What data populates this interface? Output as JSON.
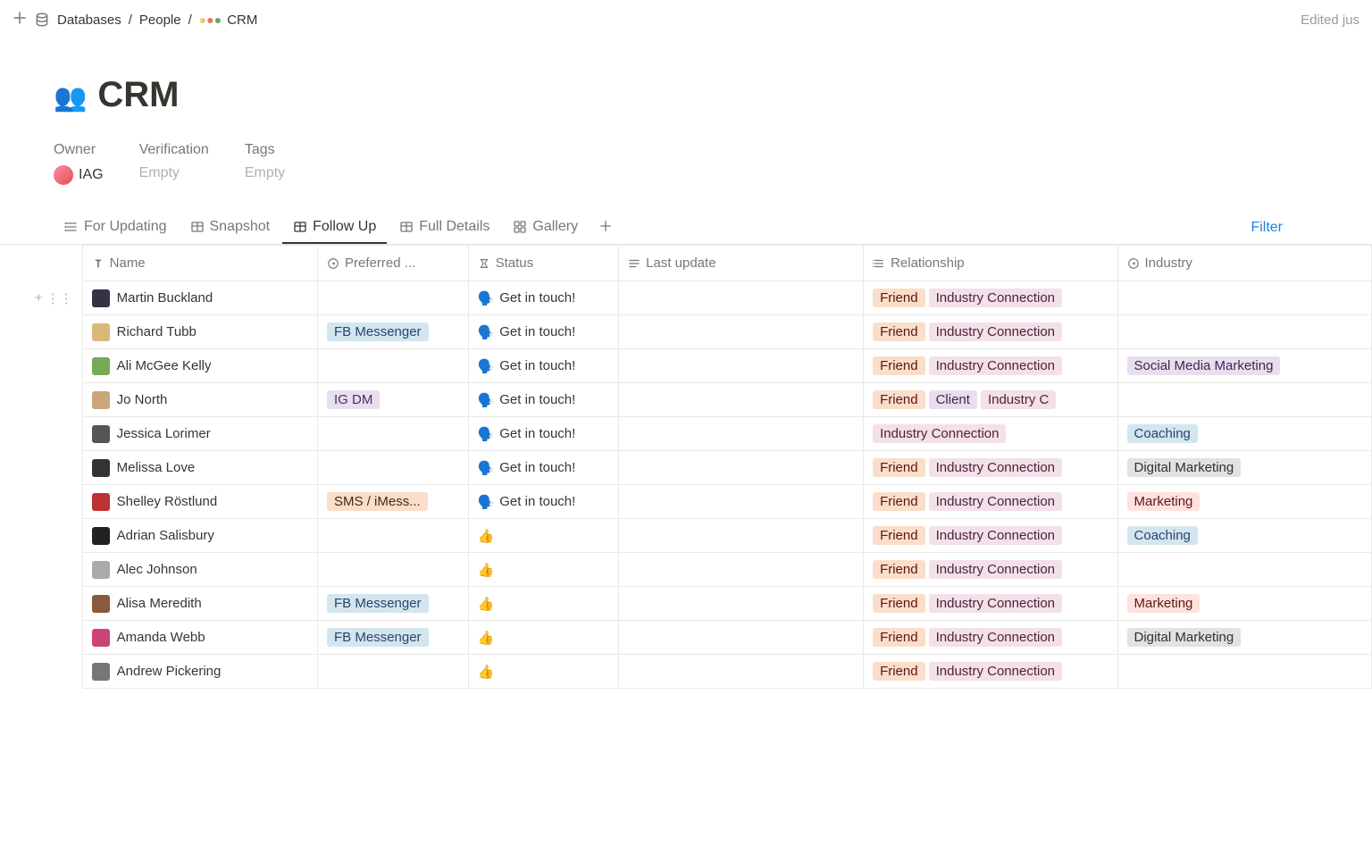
{
  "breadcrumb": {
    "root": "Databases",
    "parent": "People",
    "current": "CRM"
  },
  "edited": "Edited jus",
  "page": {
    "title": "CRM"
  },
  "props": {
    "owner_label": "Owner",
    "owner_value": "IAG",
    "verification_label": "Verification",
    "verification_value": "Empty",
    "tags_label": "Tags",
    "tags_value": "Empty"
  },
  "tabs": {
    "for_updating": "For Updating",
    "snapshot": "Snapshot",
    "follow_up": "Follow Up",
    "full_details": "Full Details",
    "gallery": "Gallery"
  },
  "filter_label": "Filter",
  "columns": {
    "name": "Name",
    "preferred": "Preferred ...",
    "status": "Status",
    "last_update": "Last update",
    "relationship": "Relationship",
    "industry": "Industry"
  },
  "emojis": {
    "get_in_touch": "🗣️",
    "thumbs_up": "👍"
  },
  "status_text": {
    "get_in_touch": "Get in touch!"
  },
  "tags": {
    "fb_messenger": "FB Messenger",
    "ig_dm": "IG DM",
    "sms": "SMS / iMess...",
    "friend": "Friend",
    "industry_conn_trunc": "Industry Connection",
    "industry_conn_short": "Industry C",
    "industry_conn_full": "Industry Connection",
    "client": "Client",
    "smm": "Social Media Marketing",
    "coaching": "Coaching",
    "dig_mkt": "Digital Marketing",
    "mkt": "Marketing"
  },
  "rows": [
    {
      "name": "Martin Buckland",
      "pref": "",
      "status": "get_in_touch",
      "rel": [
        "friend",
        "industry_conn_trunc"
      ],
      "ind": [],
      "avatar": "#334"
    },
    {
      "name": "Richard Tubb",
      "pref": "fb_messenger",
      "status": "get_in_touch",
      "rel": [
        "friend",
        "industry_conn_trunc"
      ],
      "ind": [],
      "avatar": "#d8b97a"
    },
    {
      "name": "Ali McGee Kelly",
      "pref": "",
      "status": "get_in_touch",
      "rel": [
        "friend",
        "industry_conn_trunc"
      ],
      "ind": [
        "smm"
      ],
      "avatar": "#7a5"
    },
    {
      "name": "Jo North",
      "pref": "ig_dm",
      "status": "get_in_touch",
      "rel": [
        "friend",
        "client",
        "industry_conn_short"
      ],
      "ind": [],
      "avatar": "#c9a77a"
    },
    {
      "name": "Jessica Lorimer",
      "pref": "",
      "status": "get_in_touch",
      "rel": [
        "industry_conn_full"
      ],
      "ind": [
        "coaching"
      ],
      "avatar": "#555"
    },
    {
      "name": "Melissa Love",
      "pref": "",
      "status": "get_in_touch",
      "rel": [
        "friend",
        "industry_conn_trunc"
      ],
      "ind": [
        "dig_mkt"
      ],
      "avatar": "#333"
    },
    {
      "name": "Shelley Röstlund",
      "pref": "sms",
      "status": "get_in_touch",
      "rel": [
        "friend",
        "industry_conn_trunc"
      ],
      "ind": [
        "mkt"
      ],
      "avatar": "#b33"
    },
    {
      "name": "Adrian Salisbury",
      "pref": "",
      "status": "thumbs_up",
      "rel": [
        "friend",
        "industry_conn_trunc"
      ],
      "ind": [
        "coaching"
      ],
      "avatar": "#222"
    },
    {
      "name": "Alec Johnson",
      "pref": "",
      "status": "thumbs_up",
      "rel": [
        "friend",
        "industry_conn_trunc"
      ],
      "ind": [],
      "avatar": "#aaa"
    },
    {
      "name": "Alisa Meredith",
      "pref": "fb_messenger",
      "status": "thumbs_up",
      "rel": [
        "friend",
        "industry_conn_trunc"
      ],
      "ind": [
        "mkt"
      ],
      "avatar": "#8a5a3a"
    },
    {
      "name": "Amanda Webb",
      "pref": "fb_messenger",
      "status": "thumbs_up",
      "rel": [
        "friend",
        "industry_conn_trunc"
      ],
      "ind": [
        "dig_mkt"
      ],
      "avatar": "#c47"
    },
    {
      "name": "Andrew Pickering",
      "pref": "",
      "status": "thumbs_up",
      "rel": [
        "friend",
        "industry_conn_trunc"
      ],
      "ind": [],
      "avatar": "#777"
    }
  ]
}
